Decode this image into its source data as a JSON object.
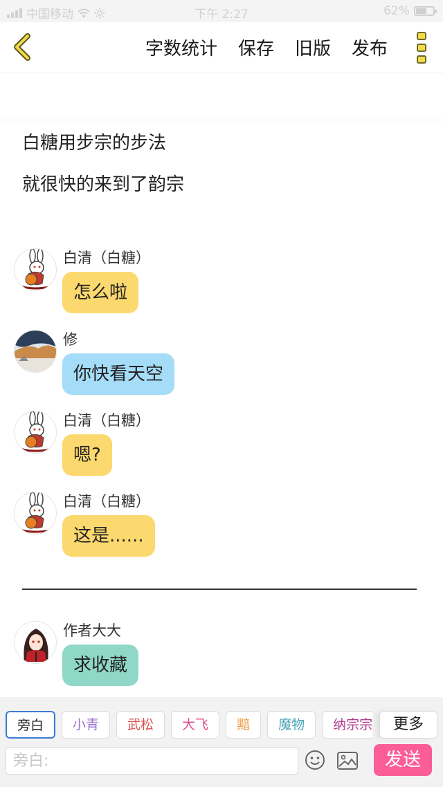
{
  "status_bar": {
    "carrier": "中国移动",
    "time": "下午 2:27",
    "battery_text": "62%",
    "battery_level": 0.62
  },
  "nav": {
    "actions": [
      "字数统计",
      "保存",
      "旧版",
      "发布"
    ]
  },
  "narration": [
    "白糖用步宗的步法",
    "就很快的来到了韵宗"
  ],
  "messages": [
    {
      "sender": "白清（白糖）",
      "text": "怎么啦",
      "color": "#fcd96e",
      "avatar": "rabbit-avatar"
    },
    {
      "sender": "修",
      "text": "你快看天空",
      "color": "#a5dcf8",
      "avatar": "landscape-avatar"
    },
    {
      "sender": "白清（白糖）",
      "text": "嗯?",
      "color": "#fcd96e",
      "avatar": "rabbit-avatar"
    },
    {
      "sender": "白清（白糖）",
      "text": "这是......",
      "color": "#fcd96e",
      "avatar": "rabbit-avatar"
    },
    {
      "sender": "作者大大",
      "text": "求收藏",
      "color": "#8fd8c7",
      "avatar": "girl-avatar"
    }
  ],
  "characters": [
    {
      "label": "旁白",
      "color": "#222222",
      "active": true
    },
    {
      "label": "小青",
      "color": "#9b6fd0",
      "active": false
    },
    {
      "label": "武松",
      "color": "#d9534f",
      "active": false
    },
    {
      "label": "大飞",
      "color": "#e0508c",
      "active": false
    },
    {
      "label": "黯",
      "color": "#f0a050",
      "active": false
    },
    {
      "label": "魔物",
      "color": "#4aa3b5",
      "active": false
    },
    {
      "label": "纳宗宗",
      "color": "#b03a8c",
      "active": false
    }
  ],
  "more_characters_label": "更多",
  "input": {
    "placeholder": "旁白:"
  },
  "send_label": "发送",
  "colors": {
    "send": "#fb5e97",
    "selected_border": "#3b7bd3"
  }
}
